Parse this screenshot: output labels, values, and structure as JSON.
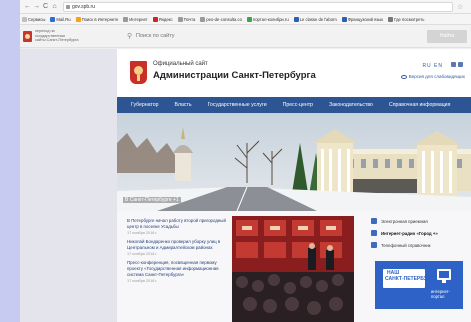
{
  "browser": {
    "nav_icons": [
      "back-icon",
      "forward-icon",
      "reload-icon",
      "home-icon"
    ],
    "url": "gov.spb.ru",
    "bookmarks": [
      {
        "label": "Сервисы",
        "color": "#c0c0c0"
      },
      {
        "label": "Mail.Ru",
        "color": "#2b6fd6"
      },
      {
        "label": "Поиск в Интернете",
        "color": "#f2a31a"
      },
      {
        "label": "Интернет",
        "color": "#9a9a9a"
      },
      {
        "label": "Яндекс",
        "color": "#d42222"
      },
      {
        "label": "Почта",
        "color": "#9a9a9a"
      },
      {
        "label": "peo-de-consulta.co",
        "color": "#9a9a9a"
      },
      {
        "label": "портал-колибри.ru",
        "color": "#3ba54a"
      },
      {
        "label": "Le classe de l'aborn",
        "color": "#2c5fb4"
      },
      {
        "label": "Французский язык",
        "color": "#2c5fb4"
      },
      {
        "label": "Где посмотреть",
        "color": "#777777"
      }
    ]
  },
  "gov_strip": {
    "line1": "переход на",
    "line2": "государственные",
    "line3": "сайты Санкт-Петербурга",
    "search_placeholder": "Поиск по сайту",
    "find_label": "Найти"
  },
  "site": {
    "subtitle": "Официальный сайт",
    "title": "Администрации Санкт-Петербурга",
    "languages": "RU EN",
    "version_link": "Версия для слабовидящих",
    "menu": [
      "Губернатор",
      "Власть",
      "Государственные услуги",
      "Пресс-центр",
      "Законодательство",
      "Справочная информация"
    ],
    "hero_caption": "В Санкт-Петербурге +1"
  },
  "news": [
    {
      "title": "В Петербурге начал работу второй пригородный центр в поселке Усадьбы",
      "date": "17 ноября 2016 г."
    },
    {
      "title": "Николай Бондаренко проверил уборку улиц в Центральном и Адмиралтейском районах",
      "date": "17 ноября 2016 г."
    },
    {
      "title": "Пресс-конференция, посвященная первому проекту «Государственная информационная система Санкт-Петербурга»",
      "date": "17 ноября 2016 г."
    }
  ],
  "sidebar": {
    "links": [
      {
        "label": "Электронная приемная",
        "bold": false
      },
      {
        "label": "Интернет-радио «Город +»",
        "bold": true
      },
      {
        "label": "Телефонный справочник",
        "bold": false
      }
    ],
    "banner_line1": "НАШ",
    "banner_line2": "САНКТ-ПЕТЕРБУРГ",
    "banner_portal": "интернет-портал"
  }
}
